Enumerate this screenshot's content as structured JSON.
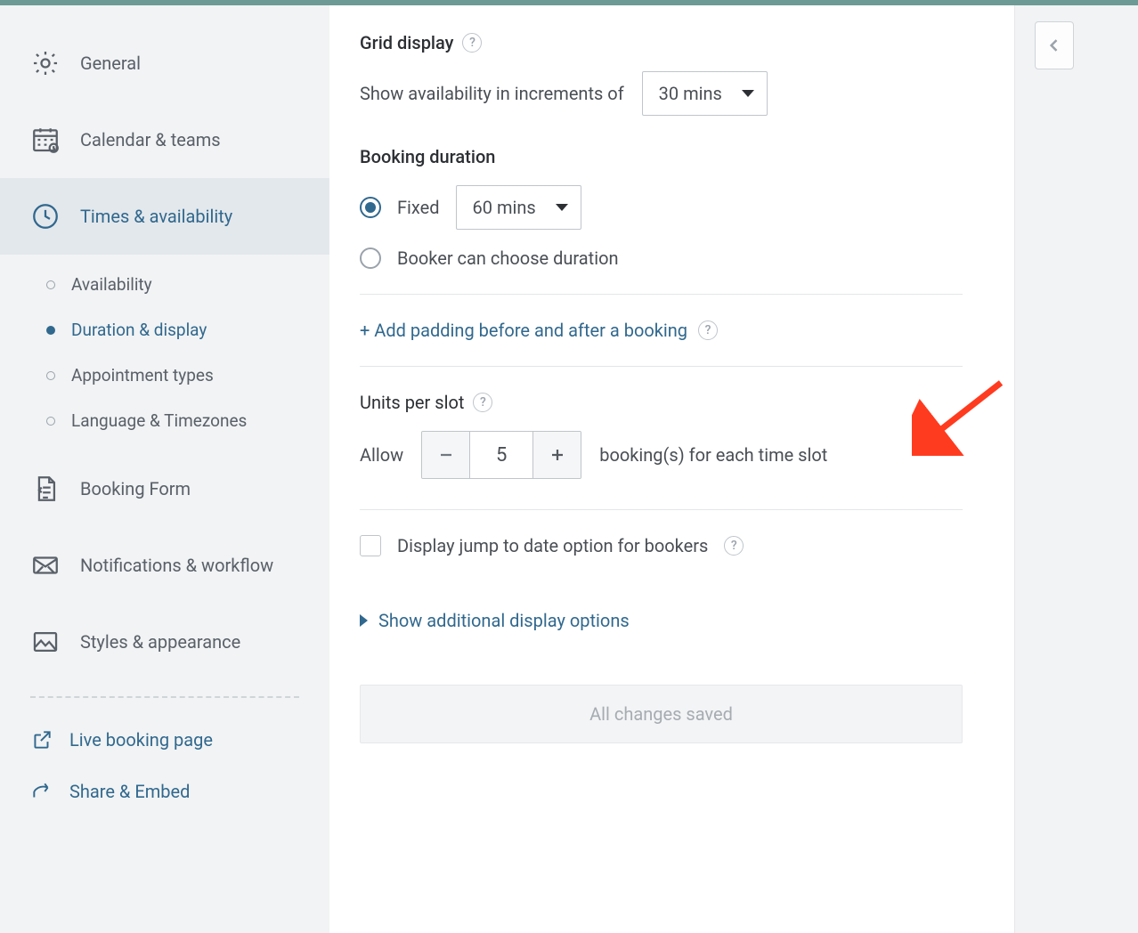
{
  "sidebar": {
    "items": [
      {
        "label": "General"
      },
      {
        "label": "Calendar & teams"
      },
      {
        "label": "Times & availability"
      },
      {
        "label": "Booking Form"
      },
      {
        "label": "Notifications & workflow"
      },
      {
        "label": "Styles & appearance"
      }
    ],
    "sub_items": [
      {
        "label": "Availability"
      },
      {
        "label": "Duration & display"
      },
      {
        "label": "Appointment types"
      },
      {
        "label": "Language & Timezones"
      }
    ],
    "links": [
      {
        "label": "Live booking page"
      },
      {
        "label": "Share & Embed"
      }
    ]
  },
  "grid_display": {
    "title": "Grid display",
    "increments_label": "Show availability in increments of",
    "increments_value": "30 mins"
  },
  "booking_duration": {
    "title": "Booking duration",
    "fixed_label": "Fixed",
    "fixed_value": "60 mins",
    "choose_label": "Booker can choose duration"
  },
  "padding": {
    "link": "+ Add padding before and after a booking"
  },
  "units_per_slot": {
    "title": "Units per slot",
    "prefix": "Allow",
    "value": "5",
    "suffix": "booking(s) for each time slot"
  },
  "jump_to_date": {
    "label": "Display jump to date option for bookers"
  },
  "additional_display": {
    "link": "Show additional display options"
  },
  "save": {
    "label": "All changes saved"
  }
}
